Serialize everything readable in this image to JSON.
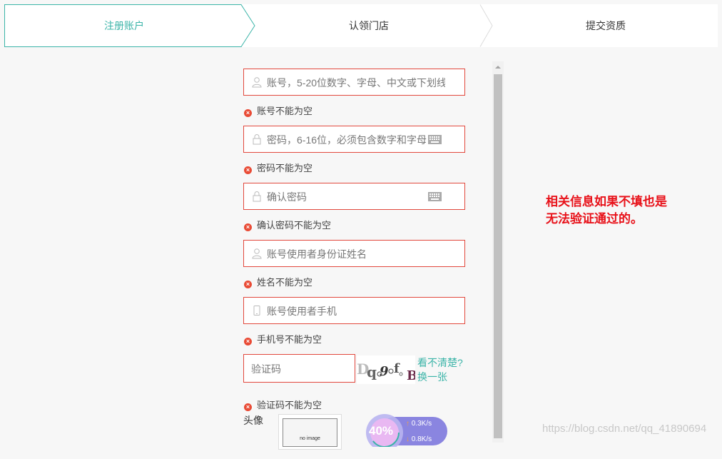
{
  "steps": [
    {
      "label": "注册账户",
      "active": true
    },
    {
      "label": "认领门店",
      "active": false
    },
    {
      "label": "提交资质",
      "active": false
    }
  ],
  "form": {
    "account_placeholder": "账号，5-20位数字、字母、中文或下划线",
    "account_error": "账号不能为空",
    "password_placeholder": "密码，6-16位，必须包含数字和字母",
    "password_error": "密码不能为空",
    "confirm_placeholder": "确认密码",
    "confirm_error": "确认密码不能为空",
    "name_placeholder": "账号使用者身份证姓名",
    "name_error": "姓名不能为空",
    "phone_placeholder": "账号使用者手机",
    "phone_error": "手机号不能为空",
    "captcha_placeholder": "验证码",
    "captcha_refresh_line1": "看不清楚?",
    "captcha_refresh_line2": "换一张",
    "captcha_text": "Dq9fB",
    "captcha_error": "验证码不能为空",
    "avatar_label": "头像",
    "avatar_placeholder": "no image"
  },
  "speed_widget": {
    "percent": "40%",
    "up": "0.3K/s",
    "down": "0.8K/s"
  },
  "annotation": {
    "line1": "相关信息如果不填也是",
    "line2": "无法验证通过的。"
  },
  "watermark": "https://blog.csdn.net/qq_41890694",
  "colors": {
    "accent": "#3bb4a8",
    "error_border": "#e2483d",
    "error_icon": "#e94b35",
    "annotation": "#e8121a"
  }
}
